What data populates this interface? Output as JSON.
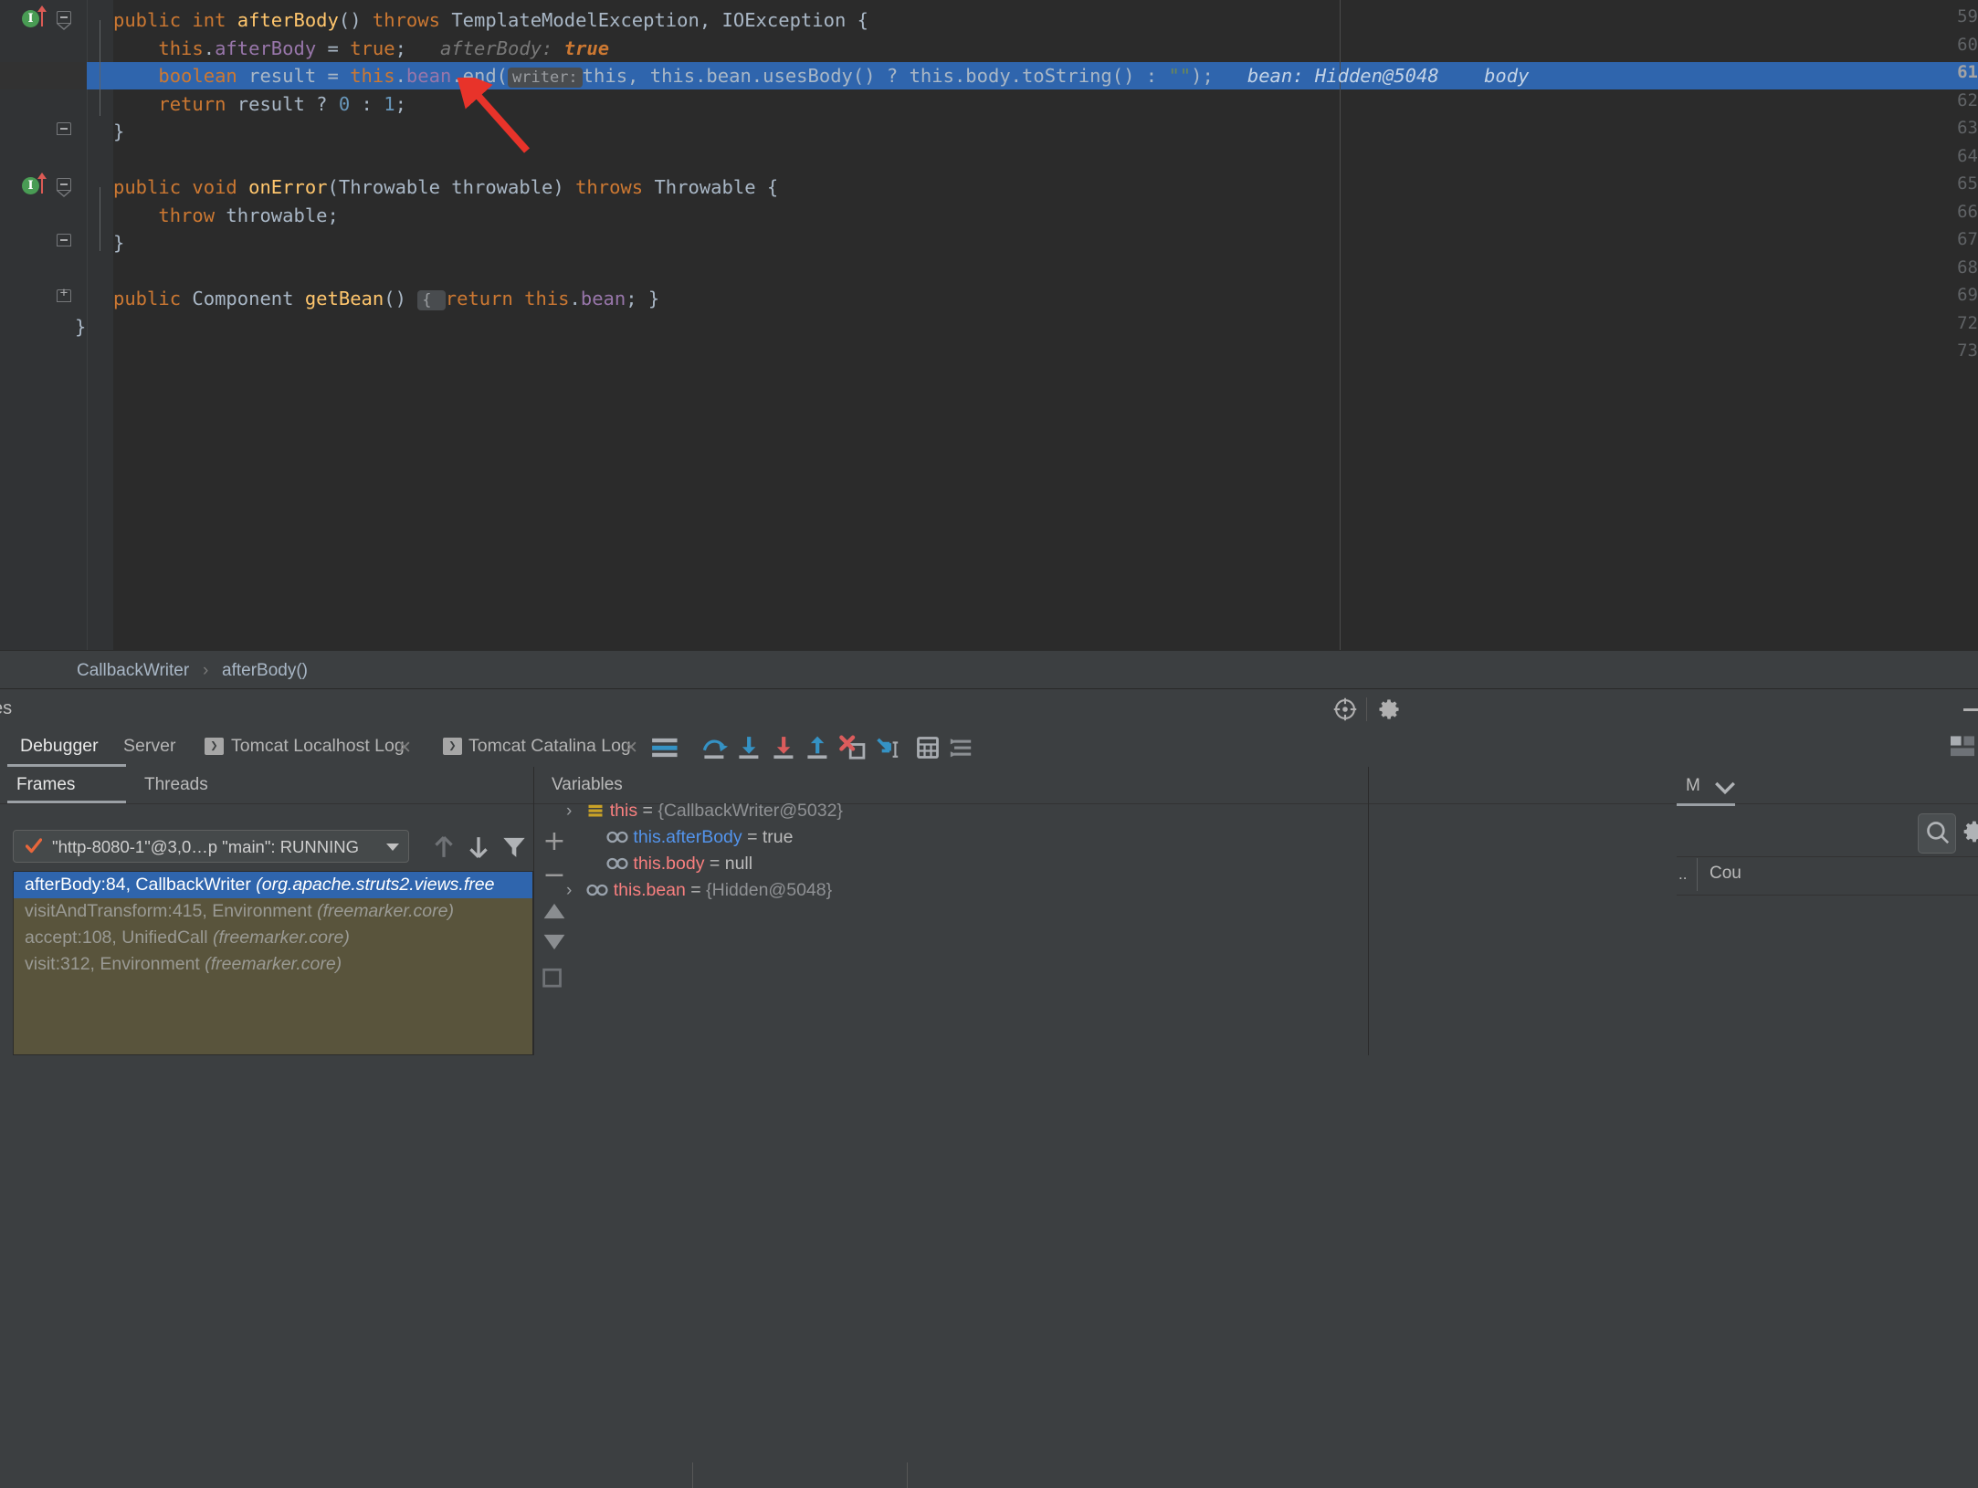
{
  "editor": {
    "gutter_lines": [
      "59",
      "60",
      "61",
      "62",
      "63",
      "64",
      "65",
      "66",
      "67",
      "68",
      "69",
      "72",
      "73"
    ],
    "current_line": "61",
    "lines": [
      {
        "n": "59",
        "parts": [
          {
            "t": "public ",
            "c": "kw"
          },
          {
            "t": "int ",
            "c": "kw"
          },
          {
            "t": "afterBody",
            "c": "mth"
          },
          {
            "t": "() ",
            "c": "pln"
          },
          {
            "t": "throws ",
            "c": "kw"
          },
          {
            "t": "TemplateModelException, IOException {",
            "c": "pln"
          }
        ]
      },
      {
        "n": "60",
        "parts": [
          {
            "t": "    this",
            "c": "kw"
          },
          {
            "t": ".",
            "c": "pln"
          },
          {
            "t": "afterBody",
            "c": "fld"
          },
          {
            "t": " = ",
            "c": "pln"
          },
          {
            "t": "true",
            "c": "kw"
          },
          {
            "t": ";",
            "c": "pln"
          },
          {
            "t": "   afterBody: ",
            "c": "hint"
          },
          {
            "t": "true",
            "c": "val"
          }
        ]
      },
      {
        "n": "61",
        "parts": [
          {
            "t": "    boolean ",
            "c": "kw"
          },
          {
            "t": "result ",
            "c": "pln"
          },
          {
            "t": "= ",
            "c": "pln"
          },
          {
            "t": "this",
            "c": "kw"
          },
          {
            "t": ".",
            "c": "pln"
          },
          {
            "t": "bean",
            "c": "fld"
          },
          {
            "t": ".end(",
            "c": "pln"
          }
        ]
      },
      {
        "n": "62",
        "parts": [
          {
            "t": "    return ",
            "c": "kw"
          },
          {
            "t": "result ? ",
            "c": "pln"
          },
          {
            "t": "0",
            "c": "num"
          },
          {
            "t": " : ",
            "c": "pln"
          },
          {
            "t": "1",
            "c": "num"
          },
          {
            "t": ";",
            "c": "pln"
          }
        ]
      },
      {
        "n": "63",
        "parts": [
          {
            "t": "}",
            "c": "pln"
          }
        ]
      },
      {
        "n": "65",
        "parts": [
          {
            "t": "public ",
            "c": "kw"
          },
          {
            "t": "void ",
            "c": "kw"
          },
          {
            "t": "onError",
            "c": "mth"
          },
          {
            "t": "(Throwable throwable) ",
            "c": "pln"
          },
          {
            "t": "throws ",
            "c": "kw"
          },
          {
            "t": "Throwable {",
            "c": "pln"
          }
        ]
      },
      {
        "n": "66",
        "parts": [
          {
            "t": "    throw ",
            "c": "kw"
          },
          {
            "t": "throwable;",
            "c": "pln"
          }
        ]
      },
      {
        "n": "67",
        "parts": [
          {
            "t": "}",
            "c": "pln"
          }
        ]
      },
      {
        "n": "69",
        "parts": [
          {
            "t": "public ",
            "c": "kw"
          },
          {
            "t": "Component ",
            "c": "pln"
          },
          {
            "t": "getBean",
            "c": "mth"
          },
          {
            "t": "() ",
            "c": "pln"
          },
          {
            "t": "{ ",
            "c": "pln"
          },
          {
            "t": "return ",
            "c": "kw"
          },
          {
            "t": "this",
            "c": "kw"
          },
          {
            "t": ".",
            "c": "pln"
          },
          {
            "t": "bean",
            "c": "fld"
          },
          {
            "t": "; }",
            "c": "pln"
          }
        ]
      },
      {
        "n": "72",
        "parts": [
          {
            "t": "}",
            "c": "pln"
          }
        ]
      }
    ],
    "line61": {
      "pre": "    boolean result = this.bean.end(",
      "inlay_label": "writer:",
      "mid": "this, this.bean.usesBody() ? this.body.toString() : ",
      "empty_string": "\"\"",
      "post": ");",
      "hint_bean": "bean: Hidden@5048",
      "hint_body": "body"
    },
    "line60_hint_name": "afterBody:",
    "line60_hint_val": "true"
  },
  "breadcrumb": {
    "class": "CallbackWriter",
    "separator": "›",
    "method": "afterBody()"
  },
  "toolwindow": {
    "title": "es",
    "pin_icon": "crosshair-icon",
    "settings_icon": "gear-icon",
    "minimize_icon": "minimize-icon"
  },
  "tabs": [
    {
      "label": "Debugger",
      "active": true,
      "closable": false,
      "run_icon": false
    },
    {
      "label": "Server",
      "active": false,
      "closable": false,
      "run_icon": false
    },
    {
      "label": "Tomcat Localhost Log",
      "active": false,
      "closable": true,
      "run_icon": true
    },
    {
      "label": "Tomcat Catalina Log",
      "active": false,
      "closable": true,
      "run_icon": true
    }
  ],
  "toolbar": [
    {
      "name": "mute-breakpoints-icon",
      "title": "Mute Breakpoints"
    },
    {
      "name": "step-over-icon",
      "title": "Step Over"
    },
    {
      "name": "step-into-icon",
      "title": "Step Into"
    },
    {
      "name": "force-step-into-icon",
      "title": "Force Step Into"
    },
    {
      "name": "step-out-icon",
      "title": "Step Out"
    },
    {
      "name": "drop-frame-icon",
      "title": "Drop Frame"
    },
    {
      "name": "run-to-cursor-icon",
      "title": "Run to Cursor"
    },
    {
      "name": "evaluate-expression-icon",
      "title": "Evaluate Expression"
    },
    {
      "name": "settings-list-icon",
      "title": "Layout Settings"
    }
  ],
  "frames_panel": {
    "tabs": [
      {
        "label": "Frames",
        "active": true
      },
      {
        "label": "Threads",
        "active": false
      }
    ],
    "thread_selector": {
      "value": "\"http-8080-1\"@3,0…p \"main\": RUNNING",
      "state_icon": "checkmark-icon"
    },
    "buttons": [
      "up-arrow-icon",
      "down-arrow-icon",
      "filter-icon"
    ],
    "frames": [
      {
        "method": "afterBody:84, CallbackWriter",
        "package": "(org.apache.struts2.views.free",
        "selected": true
      },
      {
        "method": "visitAndTransform:415, Environment",
        "package": "(freemarker.core)",
        "selected": false
      },
      {
        "method": "accept:108, UnifiedCall",
        "package": "(freemarker.core)",
        "selected": false
      },
      {
        "method": "visit:312, Environment",
        "package": "(freemarker.core)",
        "selected": false
      }
    ]
  },
  "variables_panel": {
    "title": "Variables",
    "add_button": "+",
    "remove_button": "−",
    "rows": [
      {
        "expandable": true,
        "icon": "object-stack-icon",
        "name": "this",
        "name_color": "red",
        "eq": " = ",
        "value": "{CallbackWriter@5032}"
      },
      {
        "expandable": false,
        "icon": "watch-glasses-icon",
        "name": "this.afterBody",
        "name_color": "blue",
        "eq": " = ",
        "value": "true",
        "value_plain": true
      },
      {
        "expandable": false,
        "icon": "watch-glasses-icon",
        "name": "this.body",
        "name_color": "red",
        "eq": " = ",
        "value": "null",
        "value_plain": true
      },
      {
        "expandable": true,
        "icon": "watch-glasses-icon",
        "name": "this.bean",
        "name_color": "red",
        "eq": " = ",
        "value": "{Hidden@5048}"
      }
    ]
  },
  "right_panel": {
    "tab_label": "M",
    "chevron_icon": "chevron-down-icon",
    "search_icon": "search-icon",
    "settings_icon": "gear-icon",
    "ellipsis": "..",
    "column_label": "Cou"
  },
  "colors": {
    "editor_bg": "#2b2b2b",
    "panel_bg": "#3c3f41",
    "gutter_bg": "#313335",
    "selection_blue": "#2f65ad",
    "frames_bg": "#59543c",
    "keyword_orange": "#cc7832",
    "method_yellow": "#ffc66d",
    "field_purple": "#9876aa",
    "number_blue": "#6897bb",
    "string_green": "#6a8759",
    "text_grey": "#a9b7c6",
    "var_red": "#f87f7f",
    "var_blue": "#5394ec",
    "arrow_red": "#e8332a",
    "breakpoint_green": "#499c54"
  }
}
